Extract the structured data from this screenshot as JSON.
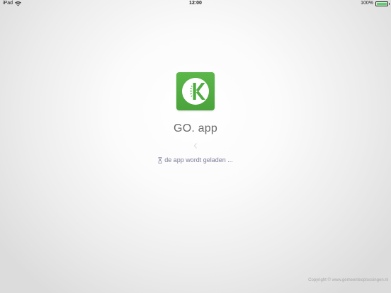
{
  "status_bar": {
    "device": "iPad",
    "time": "12:00",
    "battery_percent": "100%",
    "battery_level": 1.0,
    "battery_color": "#4cd964",
    "wifi_icon": "wifi-icon"
  },
  "app": {
    "logo_icon": "go-app-logo-icon",
    "logo_color": "#4fac40",
    "title": "GO. app",
    "back_icon": "chevron-left-icon"
  },
  "loading": {
    "icon": "hourglass-icon",
    "text": "de app wordt geladen ..."
  },
  "footer": {
    "copyright": "Copyright © www.gemeenteoplossingen.nl"
  }
}
